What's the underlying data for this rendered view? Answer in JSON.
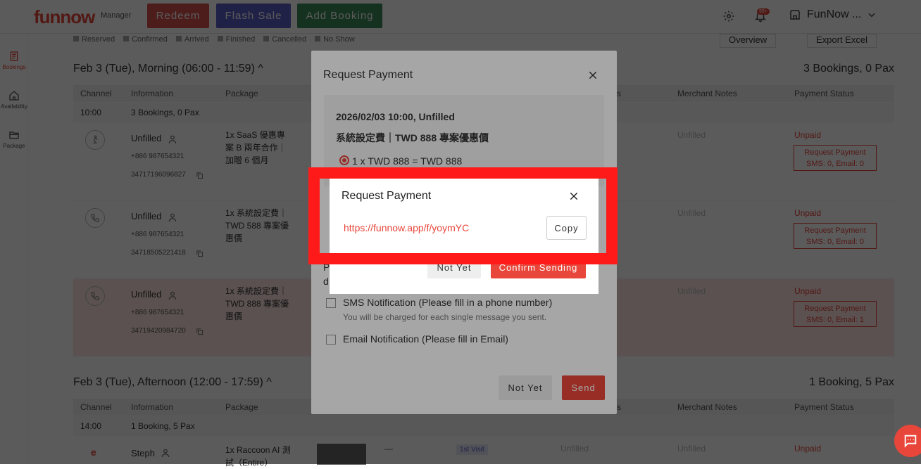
{
  "header": {
    "logo": "funnow",
    "logo_sub": "Manager",
    "btn_redeem": "Redeem",
    "btn_flash": "Flash Sale",
    "btn_add": "Add Booking",
    "notif_badge": "99+",
    "store_name": "FunNow ...",
    "colors": {
      "redeem": "#d9534f",
      "flash": "#5b5fc7",
      "add": "#3d8b5a"
    }
  },
  "sidebar": {
    "items": [
      {
        "label": "Bookings",
        "icon": "document-icon"
      },
      {
        "label": "Availability",
        "icon": "home-icon"
      },
      {
        "label": "Package",
        "icon": "folder-icon"
      }
    ]
  },
  "legend": [
    "Reserved",
    "Confirmed",
    "Arrived",
    "Finished",
    "Cancelled",
    "No Show"
  ],
  "top_actions": {
    "overview": "Overview",
    "export": "Export Excel"
  },
  "sections": [
    {
      "title": "Feb 3 (Tue), Morning (06:00 - 11:59) ^",
      "count": "3 Bookings, 0 Pax",
      "time": "10:00",
      "time_summary": "3 Bookings, 0 Pax"
    },
    {
      "title": "Feb 3 (Tue), Afternoon (12:00 - 17:59) ^",
      "count": "1 Booking, 5 Pax",
      "time": "14:00",
      "time_summary": "1 Booking, 5 Pax"
    }
  ],
  "table_headers": {
    "channel": "Channel",
    "information": "Information",
    "package": "Package",
    "merchant_notes": "Merchant Notes",
    "payment_status": "Payment Status",
    "trailing_s": "s"
  },
  "bookings": [
    {
      "name": "Unfilled",
      "phone": "+886 987654321",
      "id": "34717196096827",
      "package": "1x SaaS 優惠專案 B 兩年合作｜加贈 6 個月",
      "notes": "Unfilled",
      "status": "Unpaid",
      "pay_btn_1": "Request Payment",
      "pay_btn_2": "SMS: 0, Email: 0"
    },
    {
      "name": "Unfilled",
      "phone": "+886 987654321",
      "id": "34718505221418",
      "package": "1x 系統設定費｜TWD 588 專案優惠價",
      "notes": "Unfilled",
      "status": "Unpaid",
      "pay_btn_1": "Request Payment",
      "pay_btn_2": "SMS: 0, Email: 0"
    },
    {
      "name": "Unfilled",
      "phone": "+886 987654321",
      "id": "34719420984720",
      "package": "1x 系統設定費｜TWD 888 專案優惠價",
      "notes": "Unfilled",
      "status": "Unpaid",
      "pay_btn_1": "Request Payment",
      "pay_btn_2": "SMS: 0, Email: 1"
    }
  ],
  "afternoon_booking": {
    "name": "Steph",
    "package": "1x Raccoon AI 測試（Entire）",
    "dash": "—",
    "visit_badge": "1st Visit",
    "col_unfilled": "Unfilled",
    "notes": "Unfilled",
    "status": "Unpaid"
  },
  "modal_request": {
    "title": "Request Payment",
    "datetime": "2026/02/03 10:00, Unfilled",
    "item": "系統設定費｜TWD 888 專案優惠價",
    "line": "1 x TWD 888  =  TWD 888",
    "partial_p": "P",
    "partial_d": "d",
    "sms_label": "SMS Notification (Please fill in a phone number)",
    "sms_note": "You will be charged for each single message you sent.",
    "email_label": "Email Notification (Please fill in Email)",
    "btn_not_yet": "Not Yet",
    "btn_send": "Send"
  },
  "modal_confirm": {
    "btn_not_yet": "Not Yet",
    "btn_confirm": "Confirm Sending"
  },
  "modal_link": {
    "title": "Request Payment",
    "link": "https://funnow.app/f/yoymYC",
    "copy": "Copy"
  }
}
